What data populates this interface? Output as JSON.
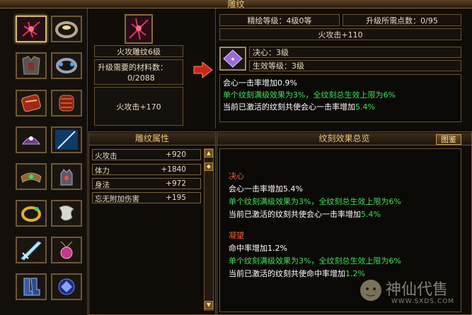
{
  "window": {
    "title": "雕纹"
  },
  "detail": {
    "item_name": "火攻雕纹6级",
    "material_label": "升级需要的材料数：",
    "material_value": "0/2088",
    "current_effect": "火攻击+170"
  },
  "upgrade": {
    "refine_level": "精绘等级：4级0等",
    "points_needed": "升级所需点数：0/95",
    "next_effect": "火攻击+110",
    "gem_name": "决心：3级",
    "effect_level": "生效等级：3级",
    "lines": [
      "会心一击率增加0.9%",
      "单个纹刻满级效果为3%，全纹刻总生效上限为6%",
      "当前已激活的纹刻共使会心一击率增加",
      "5.4%"
    ]
  },
  "attributes": {
    "title": "雕纹属性",
    "rows": [
      {
        "name": "火攻击",
        "value": "+920"
      },
      {
        "name": "体力",
        "value": "+1840"
      },
      {
        "name": "身法",
        "value": "+972"
      },
      {
        "name": "忘无附加伤害",
        "value": "+195"
      }
    ]
  },
  "overview": {
    "title": "纹刻效果总览",
    "button": "图鉴",
    "sections": [
      {
        "name": "决心",
        "line1": "会心一击率增加5.4%",
        "line2": "单个纹刻满级效果为3%，全纹刻总生效上限为6%",
        "line3": "当前已激活的纹刻共使会心一击率增加",
        "line3_value": "5.4%"
      },
      {
        "name": "凝望",
        "line1": "命中率增加1.2%",
        "line2": "单个纹刻满级效果为3%，全纹刻总生效上限为6%",
        "line3": "当前已激活的纹刻共使命中率增加",
        "line3_value": "1.2%"
      }
    ]
  },
  "watermark": {
    "cn": "神仙代售",
    "en": "WWW.SXDS.COM"
  },
  "icons": [
    "dark-rune-icon",
    "jade-ring-icon",
    "chest-armor-icon",
    "bracelet-icon",
    "red-vambrace-icon",
    "red-bracer-icon",
    "purple-crown-icon",
    "blue-blade-icon",
    "headband-icon",
    "gauntlet-icon",
    "gold-ring-icon",
    "jade-pendant-icon",
    "ice-sword-icon",
    "pink-amulet-icon",
    "boots-icon",
    "blue-charm-icon"
  ],
  "colors": {
    "accent": "#e9c37b",
    "green": "#3be05a",
    "red": "#ff5a2a"
  }
}
